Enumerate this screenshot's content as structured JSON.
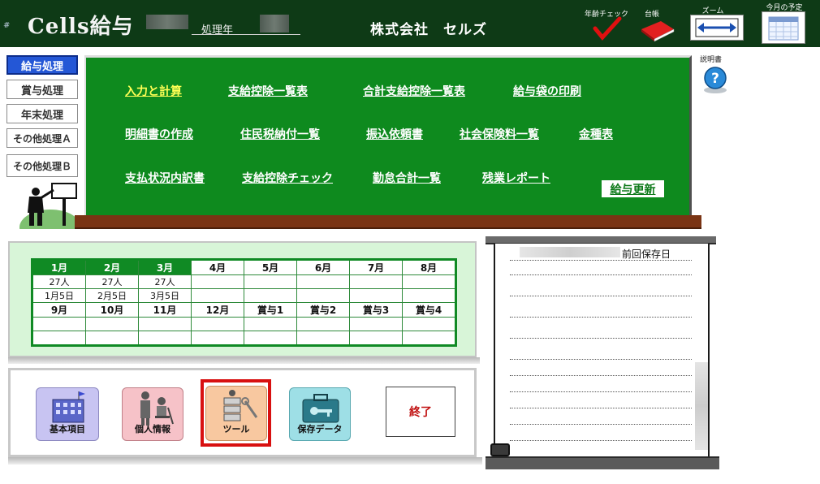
{
  "header": {
    "hash": "#",
    "title": "Cells給与",
    "processing_year_label": "処理年",
    "company_name": "株式会社　セルズ",
    "tools": [
      {
        "label": "年齢チェック",
        "icon": "check-icon"
      },
      {
        "label": "台帳",
        "icon": "ledger-book-icon"
      },
      {
        "label": "ズーム",
        "icon": "zoom-arrows-icon"
      },
      {
        "label": "今月の予定",
        "icon": "calendar-icon"
      }
    ]
  },
  "sidebar": {
    "items": [
      {
        "label": "給与処理",
        "active": true
      },
      {
        "label": "賞与処理",
        "active": false
      },
      {
        "label": "年末処理",
        "active": false
      },
      {
        "label": "その他処理Ａ",
        "active": false
      },
      {
        "label": "その他処理Ｂ",
        "active": false
      }
    ]
  },
  "board": {
    "row1": [
      "入力と計算",
      "支給控除一覧表",
      "合計支給控除一覧表",
      "給与袋の印刷"
    ],
    "row2": [
      "明細書の作成",
      "住民税納付一覧",
      "振込依頼書",
      "社会保険料一覧",
      "金種表"
    ],
    "row3": [
      "支払状況内訳書",
      "支給控除チェック",
      "勤怠合計一覧",
      "残業レポート"
    ],
    "update_button": "給与更新"
  },
  "help": {
    "label": "説明書"
  },
  "calendar": {
    "top_headers": [
      "1月",
      "2月",
      "3月",
      "4月",
      "5月",
      "6月",
      "7月",
      "8月"
    ],
    "counts": [
      "27人",
      "27人",
      "27人",
      "",
      "",
      "",
      "",
      ""
    ],
    "dates": [
      "1月5日",
      "2月5日",
      "3月5日",
      "",
      "",
      "",
      "",
      ""
    ],
    "bottom_headers": [
      "9月",
      "10月",
      "11月",
      "12月",
      "賞与1",
      "賞与2",
      "賞与3",
      "賞与4"
    ]
  },
  "launcher": {
    "items": [
      {
        "label": "基本項目",
        "color": "#c8c4f2"
      },
      {
        "label": "個人情報",
        "color": "#f6c2c8"
      },
      {
        "label": "ツール",
        "color": "#f8c8a0"
      },
      {
        "label": "保存データ",
        "color": "#9edfe6"
      }
    ],
    "exit_label": "終了"
  },
  "notes": {
    "last_saved_label": "前回保存日"
  },
  "colors": {
    "board": "#0e8a1e",
    "header": "#0e3a16",
    "accent_red": "#d81010"
  }
}
